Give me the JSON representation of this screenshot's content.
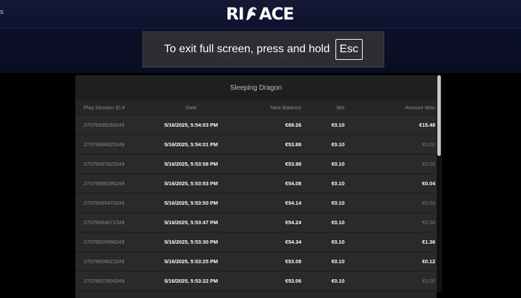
{
  "header": {
    "edge_glyph": "s",
    "logo_left": "RI",
    "logo_right": "ACE"
  },
  "background_title": "Sleeping Dragon",
  "fullscreen_toast": {
    "message": "To exit full screen, press and hold",
    "key": "Esc"
  },
  "panel": {
    "title": "Sleeping Dragon",
    "columns": {
      "session": "Play Session ID #",
      "date": "Date",
      "balance": "New Balance",
      "bet": "Bet",
      "won": "Amount Won"
    },
    "rows": [
      {
        "id": "27079939259249",
        "date": "5/16/2025, 5:54:03 PM",
        "balance": "€69.26",
        "bet": "€0.10",
        "won": "€15.48"
      },
      {
        "id": "27079938425249",
        "date": "5/16/2025, 5:54:01 PM",
        "balance": "€53.88",
        "bet": "€0.10",
        "won": "€0.00"
      },
      {
        "id": "27079937625249",
        "date": "5/16/2025, 5:53:58 PM",
        "balance": "€53.98",
        "bet": "€0.10",
        "won": "€0.00"
      },
      {
        "id": "27079936295249",
        "date": "5/16/2025, 5:53:53 PM",
        "balance": "€54.08",
        "bet": "€0.10",
        "won": "€0.04"
      },
      {
        "id": "27079935470249",
        "date": "5/16/2025, 5:53:50 PM",
        "balance": "€54.14",
        "bet": "€0.10",
        "won": "€0.00"
      },
      {
        "id": "27079934671249",
        "date": "5/16/2025, 5:53:47 PM",
        "balance": "€54.24",
        "bet": "€0.10",
        "won": "€0.00"
      },
      {
        "id": "27079929998249",
        "date": "5/16/2025, 5:53:30 PM",
        "balance": "€54.34",
        "bet": "€0.10",
        "won": "€1.36"
      },
      {
        "id": "27079928621249",
        "date": "5/16/2025, 5:53:25 PM",
        "balance": "€53.08",
        "bet": "€0.10",
        "won": "€0.12"
      },
      {
        "id": "27079927809249",
        "date": "5/16/2025, 5:53:22 PM",
        "balance": "€53.06",
        "bet": "€0.10",
        "won": "€0.00"
      }
    ]
  },
  "colors": {
    "won_positive": "#ffffff",
    "won_zero": "#7a7a7a"
  }
}
